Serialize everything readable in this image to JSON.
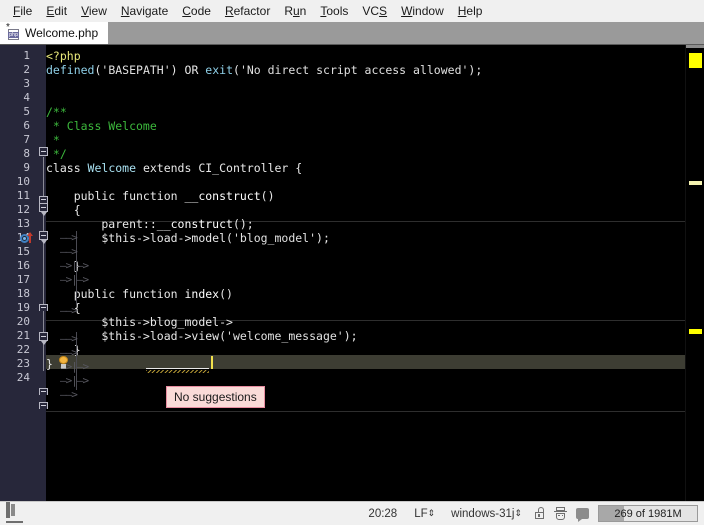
{
  "menu": {
    "items": [
      {
        "label": "File",
        "mnemonic": "F"
      },
      {
        "label": "Edit",
        "mnemonic": "E"
      },
      {
        "label": "View",
        "mnemonic": "V"
      },
      {
        "label": "Navigate",
        "mnemonic": "N"
      },
      {
        "label": "Code",
        "mnemonic": "C"
      },
      {
        "label": "Refactor",
        "mnemonic": "R"
      },
      {
        "label": "Run",
        "mnemonic": "u"
      },
      {
        "label": "Tools",
        "mnemonic": "T"
      },
      {
        "label": "VCS",
        "mnemonic": "S"
      },
      {
        "label": "Window",
        "mnemonic": "W"
      },
      {
        "label": "Help",
        "mnemonic": "H"
      }
    ]
  },
  "tabs": {
    "active": "Welcome.php",
    "items": [
      {
        "label": "Welcome.php",
        "icon": "php-file-icon",
        "modified_marker": "*"
      }
    ]
  },
  "editor": {
    "language": "php",
    "current_line": 20,
    "total_lines": 24,
    "line_numbers": [
      "1",
      "2",
      "3",
      "4",
      "5",
      "6",
      "7",
      "8",
      "9",
      "10",
      "11",
      "12",
      "13",
      "14",
      "15",
      "16",
      "17",
      "18",
      "19",
      "20",
      "21",
      "22",
      "23",
      "24"
    ],
    "lines": [
      {
        "n": 1,
        "text": "<?php"
      },
      {
        "n": 2,
        "text": "defined('BASEPATH') OR exit('No direct script access allowed');"
      },
      {
        "n": 3,
        "text": ""
      },
      {
        "n": 4,
        "text": ""
      },
      {
        "n": 5,
        "text": "/**"
      },
      {
        "n": 6,
        "text": " * Class Welcome"
      },
      {
        "n": 7,
        "text": " *"
      },
      {
        "n": 8,
        "text": " */"
      },
      {
        "n": 9,
        "text": "class Welcome extends CI_Controller {"
      },
      {
        "n": 10,
        "text": ""
      },
      {
        "n": 11,
        "text": "    public function __construct()"
      },
      {
        "n": 12,
        "text": "    {"
      },
      {
        "n": 13,
        "text": "        parent::__construct();"
      },
      {
        "n": 14,
        "text": "        $this->load->model('blog_model');"
      },
      {
        "n": 15,
        "text": ""
      },
      {
        "n": 16,
        "text": "    }"
      },
      {
        "n": 17,
        "text": ""
      },
      {
        "n": 18,
        "text": "    public function index()"
      },
      {
        "n": 19,
        "text": "    {"
      },
      {
        "n": 20,
        "text": "        $this->blog_model->"
      },
      {
        "n": 21,
        "text": "        $this->load->view('welcome_message');"
      },
      {
        "n": 22,
        "text": "    }"
      },
      {
        "n": 23,
        "text": "}"
      },
      {
        "n": 24,
        "text": ""
      }
    ],
    "gutter_icons": [
      {
        "line": 11,
        "name": "override-method-icon"
      },
      {
        "line": 20,
        "name": "intention-bulb-icon"
      }
    ],
    "popup": {
      "text": "No suggestions"
    },
    "colors": {
      "background": "#000000",
      "gutter": "#27273a",
      "comment": "#3cb83c",
      "keyword": "#e8e87a",
      "function": "#8fd0e8",
      "caret": "#f2e14c",
      "current_line": "#3d3d33",
      "marker_warning": "#ffff00"
    }
  },
  "statusbar": {
    "time": "20:28",
    "line_separator": "LF",
    "encoding": "windows-31j",
    "icons": [
      {
        "name": "lock-icon"
      },
      {
        "name": "hector-inspector-icon"
      },
      {
        "name": "event-log-bubble-icon"
      }
    ],
    "memory": {
      "label": "269 of 1981M",
      "used_percent": 25
    },
    "left_icon": {
      "name": "tool-windows-icon"
    }
  }
}
